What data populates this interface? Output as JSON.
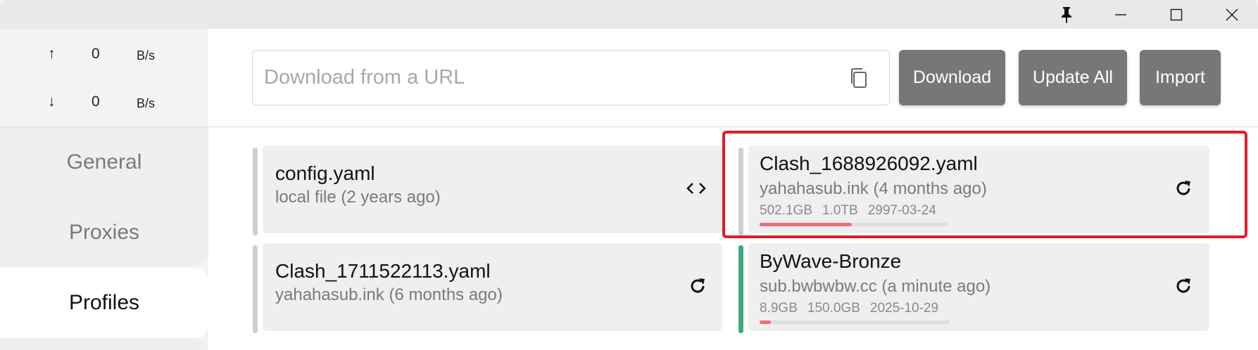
{
  "titlebar": {
    "icons": [
      "pin-icon",
      "minimize-icon",
      "maximize-icon",
      "close-icon"
    ]
  },
  "traffic": {
    "upload": {
      "arrow": "↑",
      "value": "0",
      "unit": "B/s"
    },
    "download": {
      "arrow": "↓",
      "value": "0",
      "unit": "B/s"
    }
  },
  "nav": {
    "general": "General",
    "proxies": "Proxies",
    "profiles": "Profiles",
    "active": "profiles"
  },
  "toolbar": {
    "url_placeholder": "Download from a URL",
    "url_value": "",
    "download_label": "Download",
    "update_all_label": "Update All",
    "import_label": "Import",
    "button_color": "#777777"
  },
  "profiles": [
    {
      "name": "config.yaml",
      "source": "local file (2 years ago)",
      "action_icon": "code-icon",
      "selected": false,
      "highlighted": false
    },
    {
      "name": "Clash_1688926092.yaml",
      "source": "yahahasub.ink (4 months ago)",
      "used": "502.1GB",
      "total": "1.0TB",
      "expire": "2997-03-24",
      "usage_fraction": 0.49,
      "action_icon": "refresh-icon",
      "selected": false,
      "highlighted": true
    },
    {
      "name": "Clash_1711522113.yaml",
      "source": "yahahasub.ink (6 months ago)",
      "action_icon": "refresh-icon",
      "selected": false,
      "highlighted": false
    },
    {
      "name": "ByWave-Bronze",
      "source": "sub.bwbwbw.cc (a minute ago)",
      "used": "8.9GB",
      "total": "150.0GB",
      "expire": "2025-10-29",
      "usage_fraction": 0.06,
      "action_icon": "refresh-icon",
      "selected": true,
      "highlighted": false
    }
  ],
  "colors": {
    "active_bar": "#3dab7a",
    "usage_fill": "#e8707a",
    "highlight_border": "#e31b23"
  }
}
